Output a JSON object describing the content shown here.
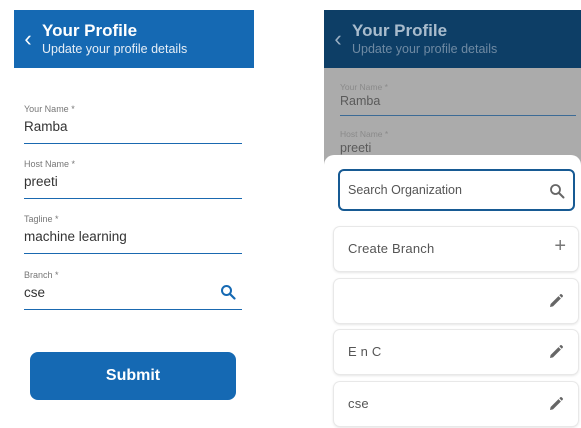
{
  "left": {
    "header": {
      "back_glyph": "‹",
      "title": "Your Profile",
      "subtitle": "Update your profile details"
    },
    "fields": [
      {
        "label": "Your Name *",
        "value": "Ramba"
      },
      {
        "label": "Host Name *",
        "value": "preeti"
      },
      {
        "label": "Tagline *",
        "value": "machine learning"
      },
      {
        "label": "Branch *",
        "value": "cse",
        "icon": "search-icon"
      }
    ],
    "submit_label": "Submit"
  },
  "right": {
    "header": {
      "back_glyph": "‹",
      "title": "Your Profile",
      "subtitle": "Update your profile details"
    },
    "fields": [
      {
        "label": "Your Name *",
        "value": "Ramba"
      },
      {
        "label": "Host Name *",
        "value": "preeti"
      }
    ],
    "sheet": {
      "search_placeholder": "Search Organization",
      "items": [
        {
          "label": "Create Branch",
          "icon": "plus-icon",
          "icon_glyph": "+"
        },
        {
          "label": "",
          "icon": "edit-icon"
        },
        {
          "label": "E n C",
          "icon": "edit-icon"
        },
        {
          "label": "cse",
          "icon": "edit-icon"
        }
      ]
    }
  },
  "colors": {
    "primary": "#1569b3",
    "header_dimmed": "#0d3e66",
    "overlay": "#ababab",
    "underline": "#1a69b0"
  }
}
